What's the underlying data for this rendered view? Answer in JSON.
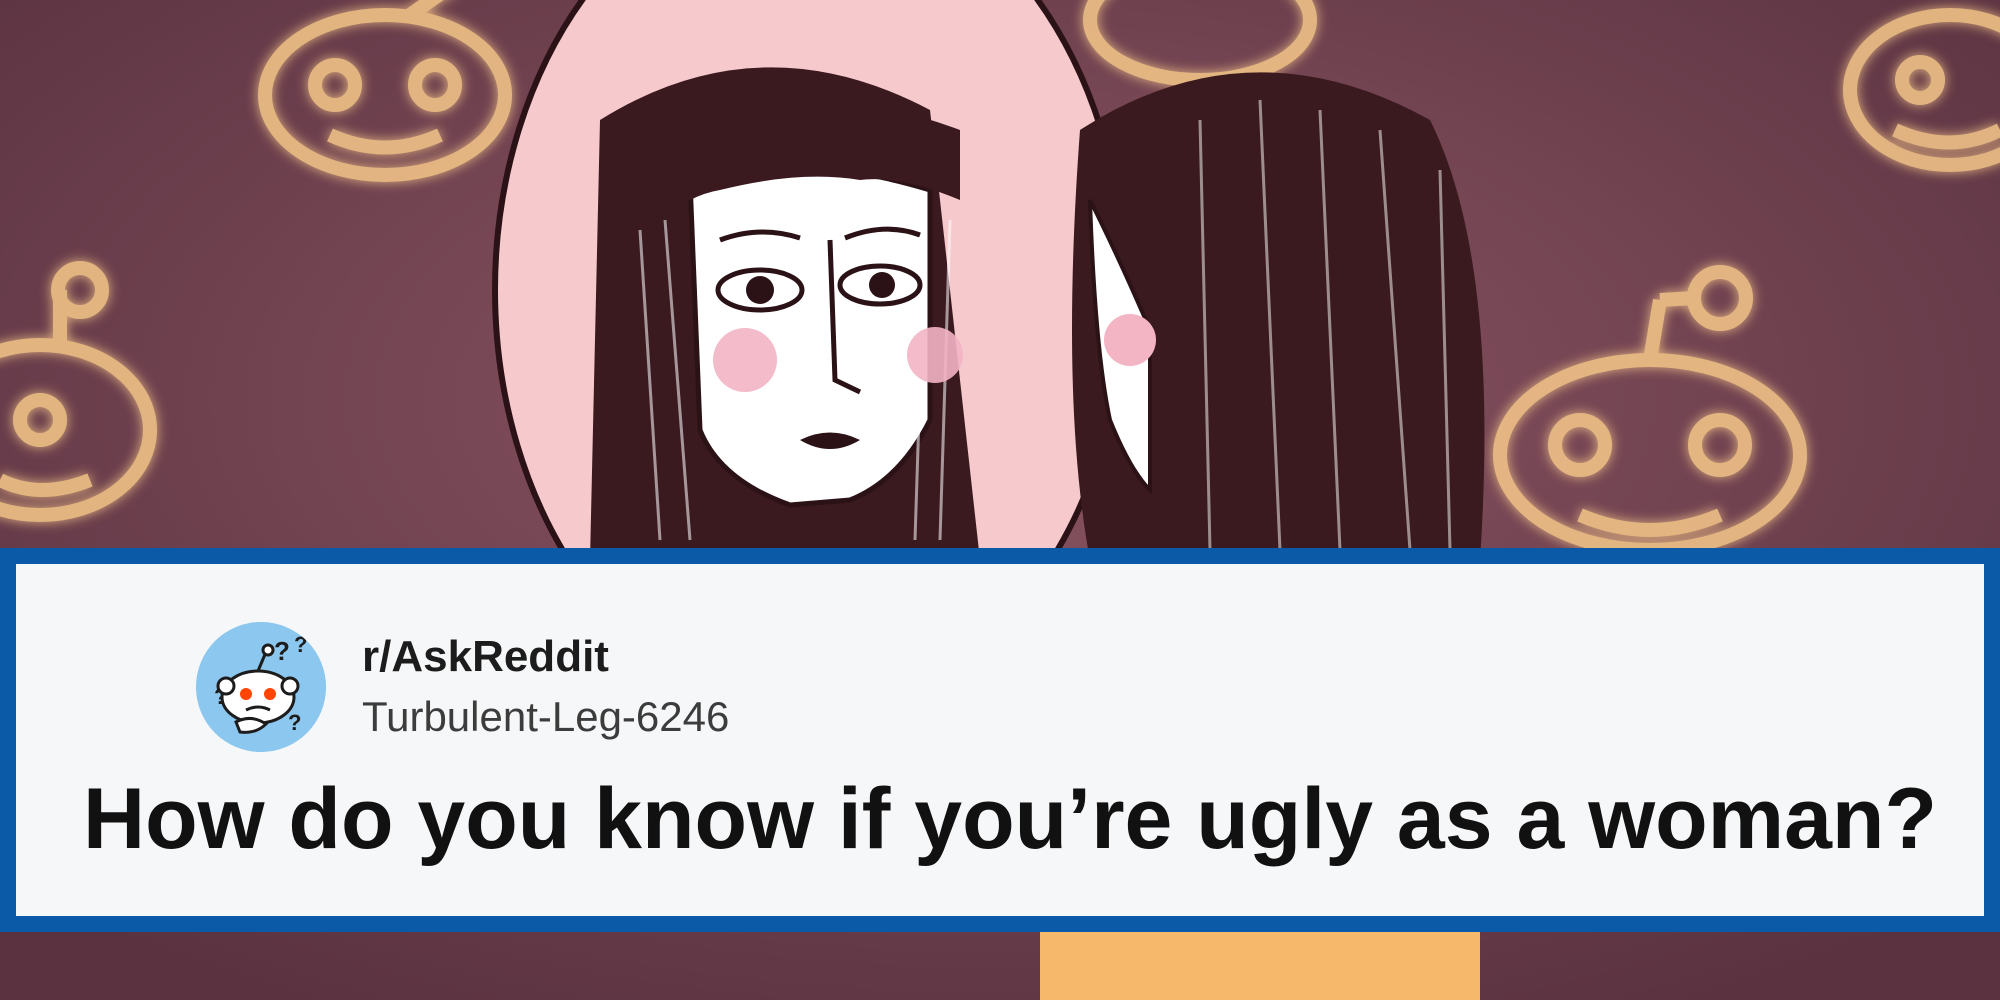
{
  "background": {
    "description_icon": "mirror-illustration",
    "colors": {
      "wall": "#6e4150",
      "mirror": "#f6c9cc",
      "hair": "#3a1a1f",
      "skin": "#ffffff",
      "blush": "#f3b4c4",
      "glow": "#f7c98a",
      "shirt": "#f6b86a"
    }
  },
  "post": {
    "subreddit": "r/AskReddit",
    "username": "Turbulent-Leg-6246",
    "title": "How do you know if you’re ugly as a woman?",
    "avatar_icon": "confused-snoo-icon",
    "colors": {
      "border": "#0a5aa8",
      "card": "#f6f7f8",
      "avatar_bg": "#8cc7ef",
      "title_text": "#111111"
    }
  }
}
